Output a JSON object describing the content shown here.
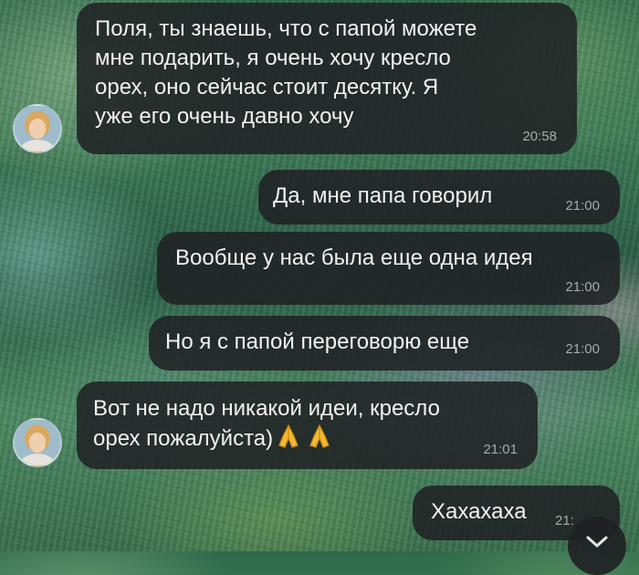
{
  "chat": {
    "messages": [
      {
        "id": "m1",
        "direction": "incoming",
        "text": "Поля, ты знаешь, что с папой можете\nмне подарить, я очень хочу кресло\nорех, оно сейчас стоит десятку. Я\nуже его очень давно хочу",
        "time": "20:58"
      },
      {
        "id": "m2",
        "direction": "outgoing",
        "text": "Да, мне папа говорил",
        "time": "21:00"
      },
      {
        "id": "m3",
        "direction": "outgoing",
        "text": "Вообще у нас была еще одна идея",
        "time": "21:00"
      },
      {
        "id": "m4",
        "direction": "outgoing",
        "text": "Но я с папой переговорю еще",
        "time": "21:00"
      },
      {
        "id": "m5",
        "direction": "incoming",
        "text": "Вот не надо никакой идеи, кресло\nорех пожалуйста)",
        "emoji": [
          "folded-hands-icon",
          "folded-hands-icon"
        ],
        "time": "21:01"
      },
      {
        "id": "m6",
        "direction": "outgoing",
        "text": "Хахахаха",
        "time": "21:"
      }
    ]
  },
  "icons": {
    "scroll_down": "chevron-down-icon",
    "avatar": "avatar"
  },
  "colors": {
    "bubble_bg": "#202224",
    "bubble_text": "#f2f2f2",
    "time_text": "#a9a9a9",
    "emoji_color": "#f5b82e"
  }
}
